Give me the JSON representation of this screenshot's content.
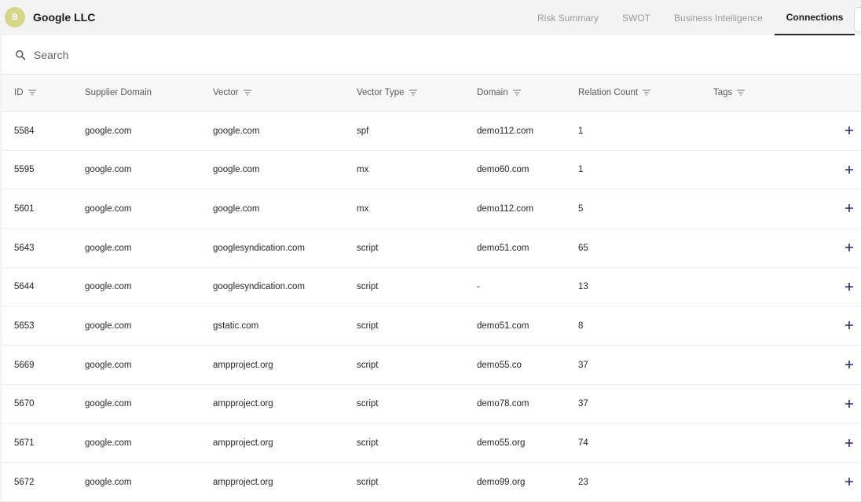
{
  "header": {
    "avatar_letter": "B",
    "company_name": "Google LLC",
    "tabs": [
      {
        "label": "Risk Summary",
        "active": false
      },
      {
        "label": "SWOT",
        "active": false
      },
      {
        "label": "Business Intelligence",
        "active": false
      },
      {
        "label": "Connections",
        "active": true
      }
    ]
  },
  "search": {
    "placeholder": "Search",
    "value": "",
    "icon": "search-icon"
  },
  "table": {
    "columns": [
      {
        "label": "ID",
        "filter": true
      },
      {
        "label": "Supplier Domain",
        "filter": false
      },
      {
        "label": "Vector",
        "filter": true
      },
      {
        "label": "Vector Type",
        "filter": true
      },
      {
        "label": "Domain",
        "filter": true
      },
      {
        "label": "Relation Count",
        "filter": true
      },
      {
        "label": "Tags",
        "filter": true
      }
    ],
    "rows": [
      {
        "id": "5584",
        "supplier_domain": "google.com",
        "vector": "google.com",
        "vector_type": "spf",
        "domain": "demo112.com",
        "relation_count": "1",
        "tags": ""
      },
      {
        "id": "5595",
        "supplier_domain": "google.com",
        "vector": "google.com",
        "vector_type": "mx",
        "domain": "demo60.com",
        "relation_count": "1",
        "tags": ""
      },
      {
        "id": "5601",
        "supplier_domain": "google.com",
        "vector": "google.com",
        "vector_type": "mx",
        "domain": "demo112.com",
        "relation_count": "5",
        "tags": ""
      },
      {
        "id": "5643",
        "supplier_domain": "google.com",
        "vector": "googlesyndication.com",
        "vector_type": "script",
        "domain": "demo51.com",
        "relation_count": "65",
        "tags": ""
      },
      {
        "id": "5644",
        "supplier_domain": "google.com",
        "vector": "googlesyndication.com",
        "vector_type": "script",
        "domain": "-",
        "relation_count": "13",
        "tags": ""
      },
      {
        "id": "5653",
        "supplier_domain": "google.com",
        "vector": "gstatic.com",
        "vector_type": "script",
        "domain": "demo51.com",
        "relation_count": "8",
        "tags": ""
      },
      {
        "id": "5669",
        "supplier_domain": "google.com",
        "vector": "ampproject.org",
        "vector_type": "script",
        "domain": "demo55.co",
        "relation_count": "37",
        "tags": ""
      },
      {
        "id": "5670",
        "supplier_domain": "google.com",
        "vector": "ampproject.org",
        "vector_type": "script",
        "domain": "demo78.com",
        "relation_count": "37",
        "tags": ""
      },
      {
        "id": "5671",
        "supplier_domain": "google.com",
        "vector": "ampproject.org",
        "vector_type": "script",
        "domain": "demo55.org",
        "relation_count": "74",
        "tags": ""
      },
      {
        "id": "5672",
        "supplier_domain": "google.com",
        "vector": "ampproject.org",
        "vector_type": "script",
        "domain": "demo99.org",
        "relation_count": "23",
        "tags": ""
      }
    ],
    "row_action_icon": "plus-icon"
  },
  "colors": {
    "avatar_bg": "#d6d58a",
    "action_icon": "#2b2d6e",
    "active_tab_underline": "#2a2a2a"
  }
}
